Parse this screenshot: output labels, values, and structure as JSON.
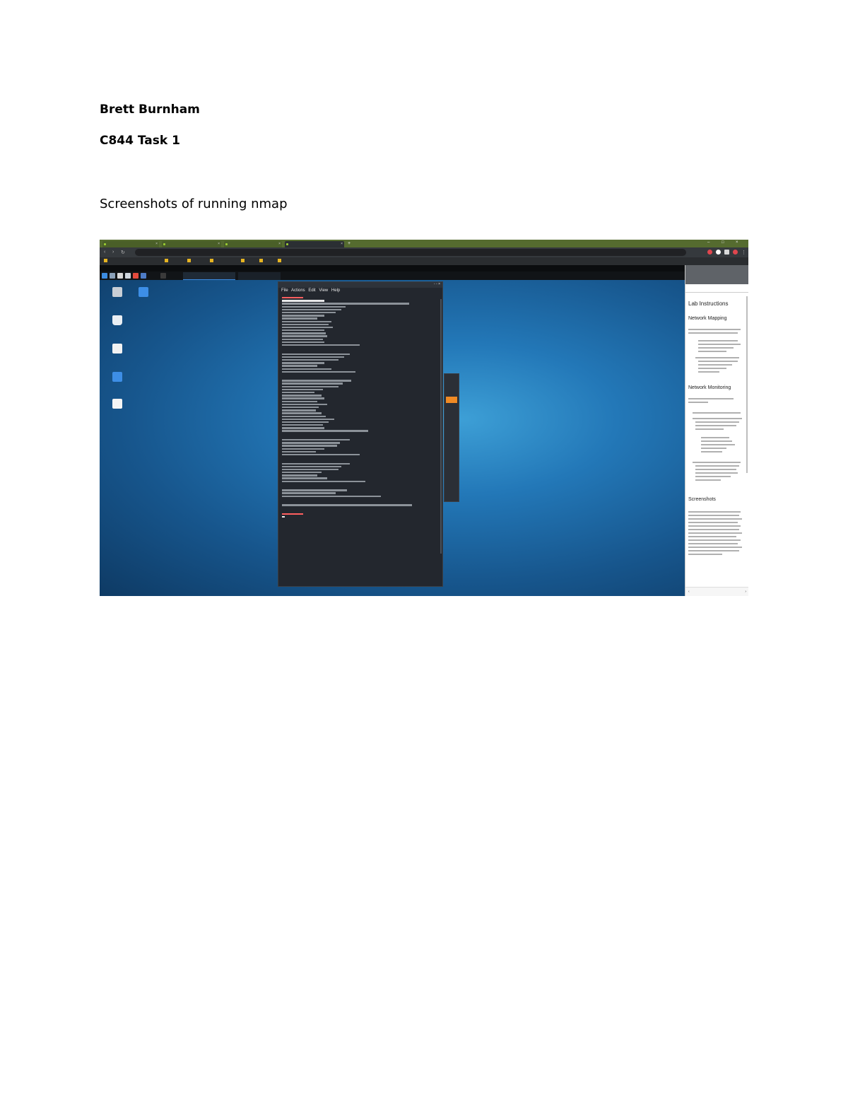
{
  "document": {
    "author": "Brett Burnham",
    "course": "C844 Task 1",
    "caption": "Screenshots of running nmap"
  },
  "screenshot": {
    "colors": {
      "browser_frame": "#556b2f",
      "desktop": "#1d6aa6",
      "terminal": "#23272e",
      "accent_orange": "#f08a24"
    },
    "terminal_menu": "File Actions Edit View Help",
    "panel": {
      "headings": [
        "Lab Instructions",
        "Network Mapping",
        "Network Monitoring",
        "Screenshots"
      ]
    },
    "icons": [
      "home-folder-icon",
      "trash-icon",
      "file-system-icon",
      "home-icon",
      "text-file-icon"
    ]
  }
}
